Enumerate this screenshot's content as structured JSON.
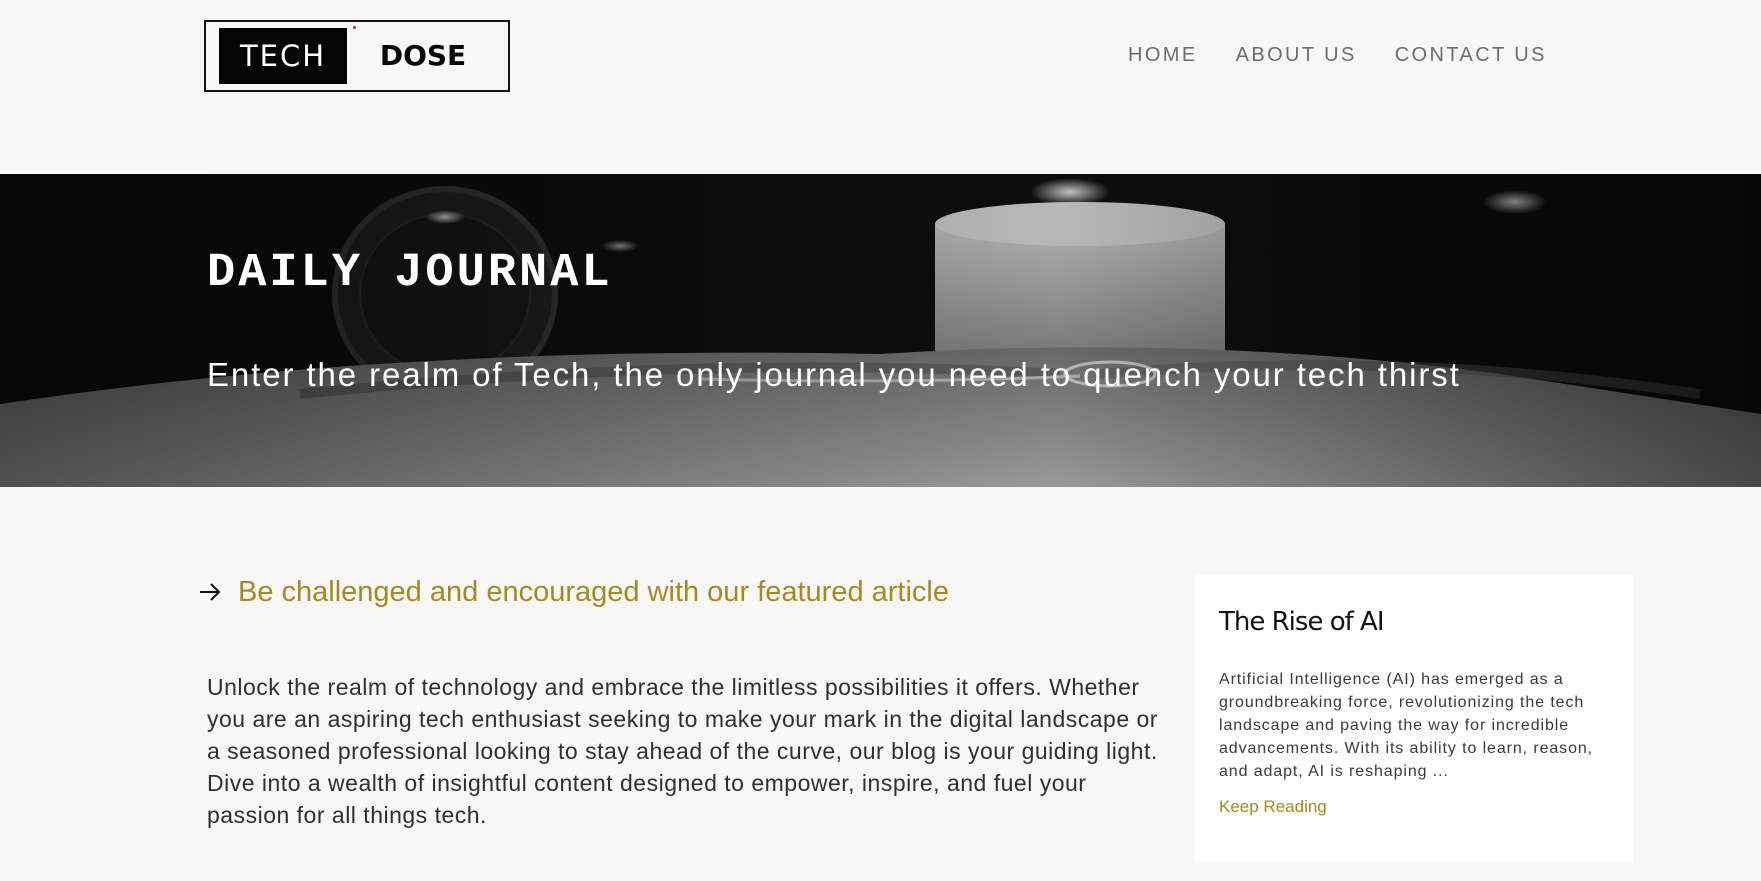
{
  "brand": {
    "logo_left": "TECH",
    "logo_right": "DOSE"
  },
  "nav": {
    "items": [
      "HOME",
      "ABOUT US",
      "CONTACT US"
    ]
  },
  "hero": {
    "title": "DAILY JOURNAL",
    "subtitle": "Enter the realm of Tech, the only journal you need to quench your tech thirst"
  },
  "featured": {
    "heading": "Be challenged and encouraged with our featured article",
    "intro": "Unlock the realm of technology and embrace the limitless possibilities it offers. Whether you are an aspiring tech enthusiast seeking to make your mark in the digital landscape or a seasoned professional looking to stay ahead of the curve, our blog is your guiding light. Dive into a wealth of insightful content designed to empower, inspire, and fuel your passion for all things tech."
  },
  "article_card": {
    "title": "The Rise of AI",
    "excerpt": "Artificial Intelligence (AI) has emerged as a groundbreaking force, revolutionizing the tech landscape and paving the way for incredible advancements. With its ability to learn, reason, and adapt, AI is reshaping ...",
    "link_label": "Keep Reading"
  },
  "colors": {
    "background": "#f7f7f7",
    "accent_gold": "#a8891f",
    "nav_text": "#6d6d6d",
    "logo_black": "#050505",
    "card_bg": "#ffffff"
  },
  "icons": {
    "featured_arrow": "arrow-right-icon"
  }
}
